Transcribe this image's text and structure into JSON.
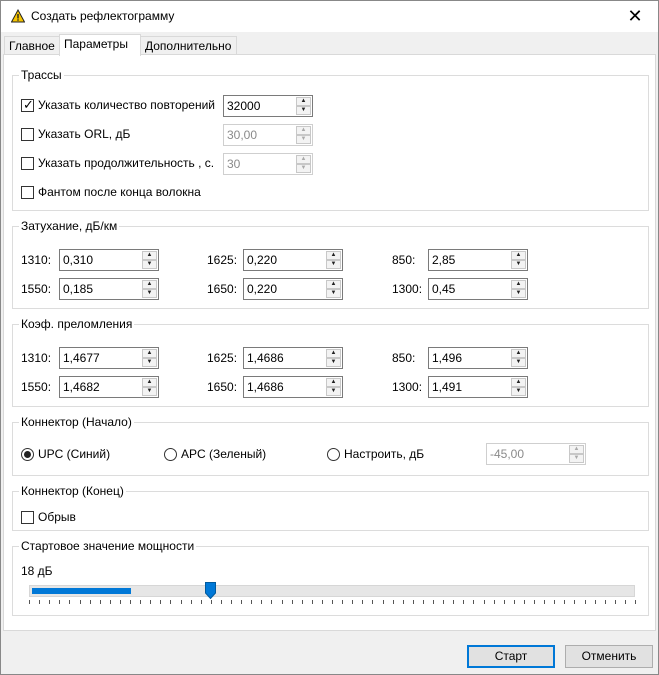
{
  "window": {
    "title": "Создать рефлектограмму",
    "close_glyph": "✕"
  },
  "tabs": [
    {
      "label": "Главное",
      "active": false
    },
    {
      "label": "Параметры",
      "active": true
    },
    {
      "label": "Дополнительно",
      "active": false
    }
  ],
  "traces": {
    "title": "Трассы",
    "repeat": {
      "label": "Указать количество повторений",
      "checked": true,
      "value": "32000"
    },
    "orl": {
      "label": "Указать ORL, дБ",
      "checked": false,
      "value": "30,00"
    },
    "duration": {
      "label": "Указать продолжительность , с.",
      "checked": false,
      "value": "30"
    },
    "phantom": {
      "label": "Фантом после конца волокна",
      "checked": false
    }
  },
  "attenuation": {
    "title": "Затухание,  дБ/км",
    "rows": [
      [
        {
          "label": "1310:",
          "value": "0,310"
        },
        {
          "label": "1625:",
          "value": "0,220"
        },
        {
          "label": "850:",
          "value": "2,85"
        }
      ],
      [
        {
          "label": "1550:",
          "value": "0,185"
        },
        {
          "label": "1650:",
          "value": "0,220"
        },
        {
          "label": "1300:",
          "value": "0,45"
        }
      ]
    ]
  },
  "refraction": {
    "title": "Коэф. преломления",
    "rows": [
      [
        {
          "label": "1310:",
          "value": "1,4677"
        },
        {
          "label": "1625:",
          "value": "1,4686"
        },
        {
          "label": "850:",
          "value": "1,496"
        }
      ],
      [
        {
          "label": "1550:",
          "value": "1,4682"
        },
        {
          "label": "1650:",
          "value": "1,4686"
        },
        {
          "label": "1300:",
          "value": "1,491"
        }
      ]
    ]
  },
  "connector_start": {
    "title": "Коннектор (Начало)",
    "upc": {
      "label": "UPC (Синий)",
      "selected": true
    },
    "apc": {
      "label": "APC (Зеленый)",
      "selected": false
    },
    "custom": {
      "label": "Настроить,  дБ",
      "selected": false,
      "value": "-45,00"
    }
  },
  "connector_end": {
    "title": "Коннектор (Конец)",
    "break": {
      "label": "Обрыв",
      "checked": false
    }
  },
  "power": {
    "title": "Стартовое значение мощности",
    "value_label": "18 дБ",
    "slider_fraction": 0.3
  },
  "footer": {
    "start_label": "Старт",
    "cancel_label": "Отменить"
  },
  "colors": {
    "accent": "#0078d7",
    "warning_icon": "#f5c400"
  }
}
